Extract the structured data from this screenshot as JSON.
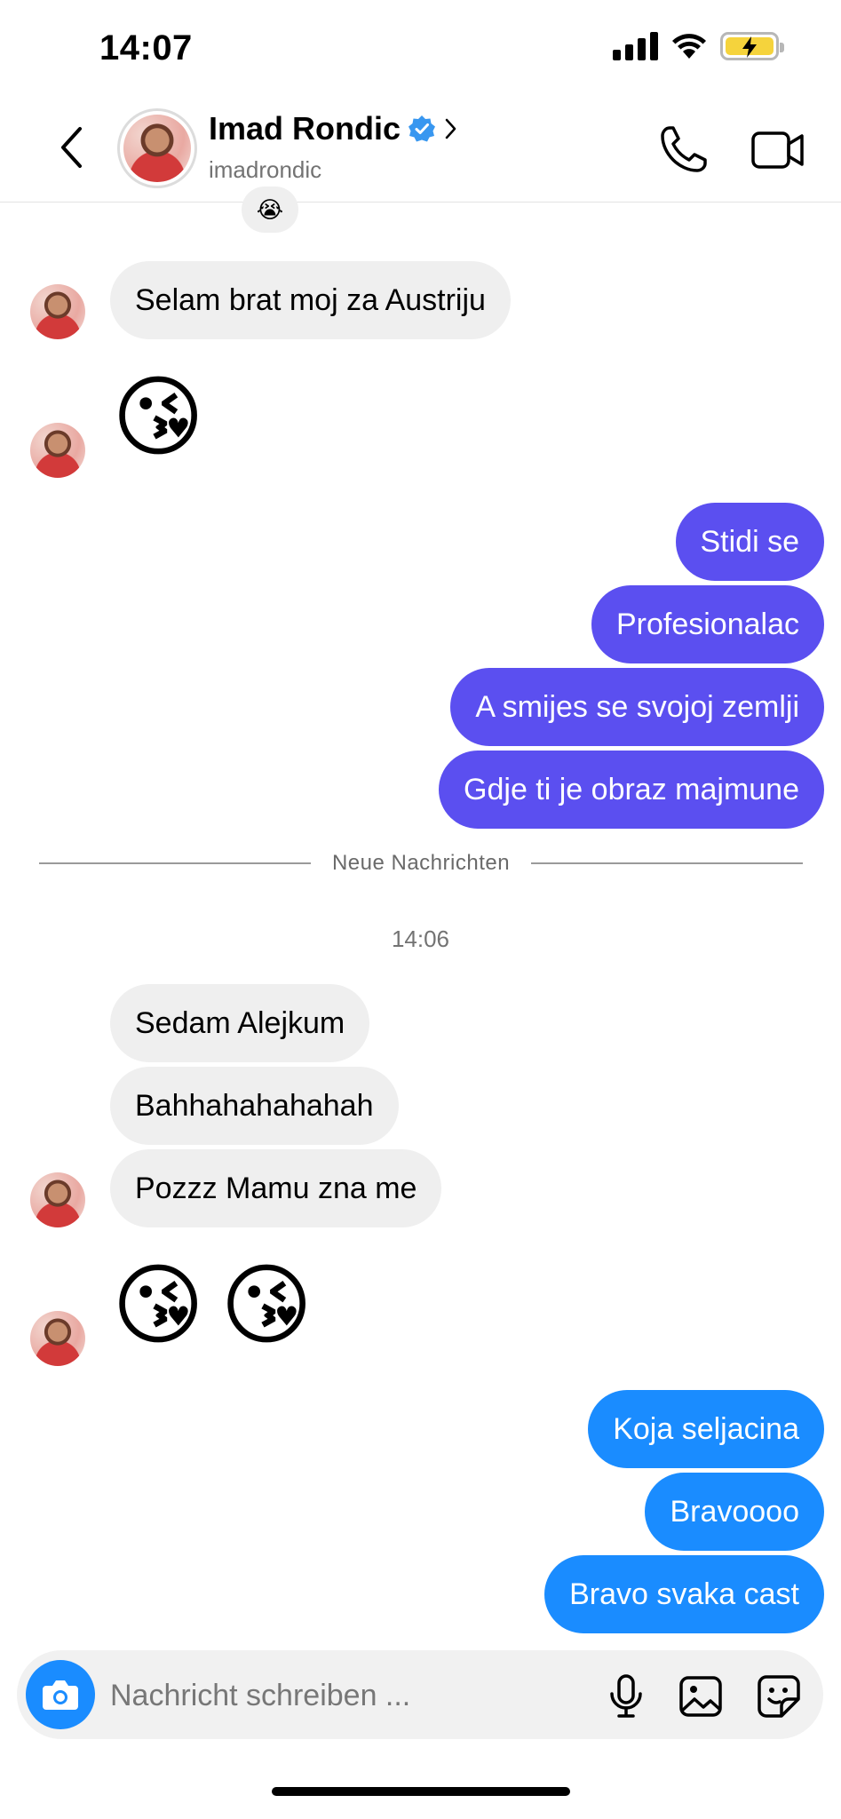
{
  "status_bar": {
    "time": "14:07"
  },
  "header": {
    "contact_name": "Imad Rondic",
    "username": "imadrondic",
    "verified": true
  },
  "messages": {
    "reaction_emoji": "😭",
    "incoming_1": "Selam brat moj za Austriju",
    "incoming_emoji_1": "😘",
    "outgoing_1": [
      "Stidi se",
      "Profesionalac",
      "A smijes se svojoj zemlji",
      "Gdje ti je obraz majmune"
    ],
    "divider_label": "Neue Nachrichten",
    "timestamp": "14:06",
    "incoming_2": [
      "Sedam Alejkum",
      "Bahhahahahahah",
      "Pozzz Mamu zna me"
    ],
    "incoming_emoji_2": [
      "😘",
      "😘"
    ],
    "outgoing_2": [
      "Koja seljacina",
      "Bravoooo",
      "Bravo svaka cast"
    ]
  },
  "composer": {
    "placeholder": "Nachricht schreiben ..."
  },
  "colors": {
    "outgoing_purple": "#5b4ff0",
    "outgoing_blue": "#1a8cff",
    "incoming_bg": "#efefef",
    "verified_badge": "#3897f0"
  },
  "icons": {
    "back": "chevron-left-icon",
    "call": "phone-icon",
    "video": "video-camera-icon",
    "camera": "camera-icon",
    "mic": "microphone-icon",
    "gallery": "image-icon",
    "sticker": "sticker-icon"
  }
}
